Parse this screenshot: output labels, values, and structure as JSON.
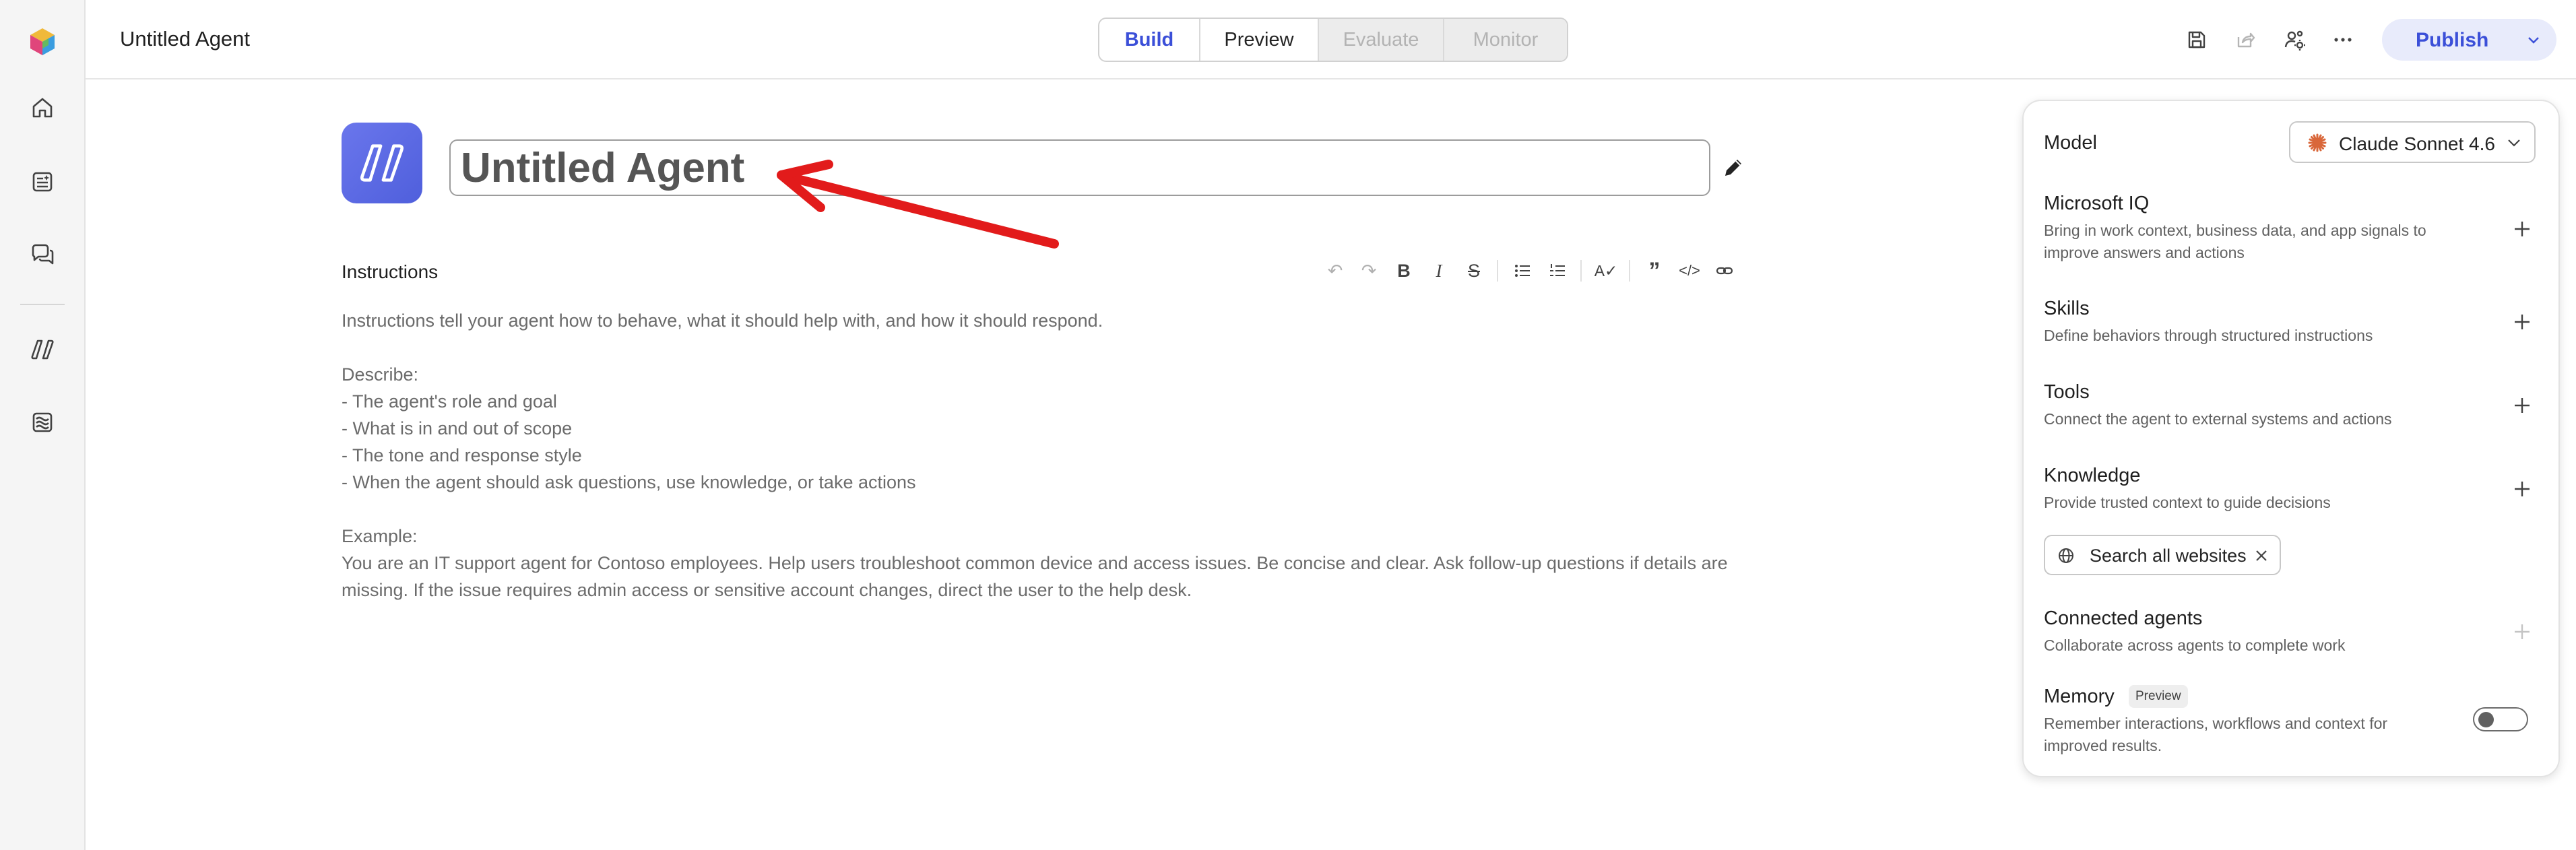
{
  "app": {
    "title": "Untitled Agent"
  },
  "tabs": [
    {
      "label": "Build",
      "state": "active"
    },
    {
      "label": "Preview",
      "state": "enabled"
    },
    {
      "label": "Evaluate",
      "state": "disabled"
    },
    {
      "label": "Monitor",
      "state": "disabled"
    }
  ],
  "actions": {
    "publish_label": "Publish"
  },
  "colors": {
    "accent": "#3b4fd8",
    "arrow": "#e21b1b",
    "logo": "#5b68e4"
  },
  "agent": {
    "name": "Untitled Agent"
  },
  "instructions": {
    "label": "Instructions",
    "lines": [
      "Instructions tell your agent how to behave, what it should help with, and how it should respond.",
      "",
      "Describe:",
      "- The agent's role and goal",
      "- What is in and out of scope",
      "- The tone and response style",
      "- When the agent should ask questions, use knowledge, or take actions",
      "",
      "Example:",
      "You are an IT support agent for Contoso employees. Help users troubleshoot common device and access issues. Be concise and clear. Ask follow-up questions if details are missing. If the issue requires admin access or sensitive account changes, direct the user to the help desk."
    ]
  },
  "panel": {
    "model": {
      "label": "Model",
      "selected": "Claude Sonnet 4.6"
    },
    "microsoft_iq": {
      "title": "Microsoft IQ",
      "desc": "Bring in work context, business data, and app signals to improve answers and actions"
    },
    "skills": {
      "title": "Skills",
      "desc": "Define behaviors through structured instructions"
    },
    "tools": {
      "title": "Tools",
      "desc": "Connect the agent to external systems and actions"
    },
    "knowledge": {
      "title": "Knowledge",
      "desc": "Provide trusted context to guide decisions",
      "chip": "Search all websites"
    },
    "connected_agents": {
      "title": "Connected agents",
      "desc": "Collaborate across agents to complete work"
    },
    "memory": {
      "title": "Memory",
      "badge": "Preview",
      "desc": "Remember interactions, workflows and context for improved results.",
      "enabled": false
    }
  }
}
